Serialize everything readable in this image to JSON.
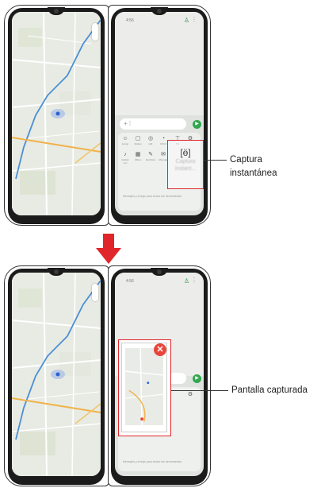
{
  "top": {
    "status_time": "4:56",
    "capture_tile_label": "Captura instant...",
    "callout": "Captura instantánea",
    "hint_text": "Mensajes y emojis para enviar las herramientas"
  },
  "bottom": {
    "status_time": "4:56",
    "callout": "Pantalla capturada",
    "hint_text": "Mensajes y emojis para enviar las herramientas"
  },
  "tools_row1": [
    {
      "icon": "☺",
      "label": "Emoji"
    },
    {
      "icon": "▢",
      "label": "Sticker"
    },
    {
      "icon": "◎",
      "label": "GIF"
    },
    {
      "icon": "◔",
      "label": "Mi Gf"
    },
    {
      "icon": "⊤",
      "label": "Txt"
    },
    {
      "icon": "⚙",
      "label": ""
    }
  ],
  "tools_row2": [
    {
      "icon": "♪",
      "label": "Grabar voz"
    },
    {
      "icon": "▦",
      "label": "Último"
    },
    {
      "icon": "✎",
      "label": "Escritura"
    },
    {
      "icon": "✉",
      "label": "Mensaje"
    }
  ],
  "colors": {
    "accent_red": "#e0262b",
    "send_green": "#2fa84f",
    "route_blue": "#4a8fd6"
  }
}
